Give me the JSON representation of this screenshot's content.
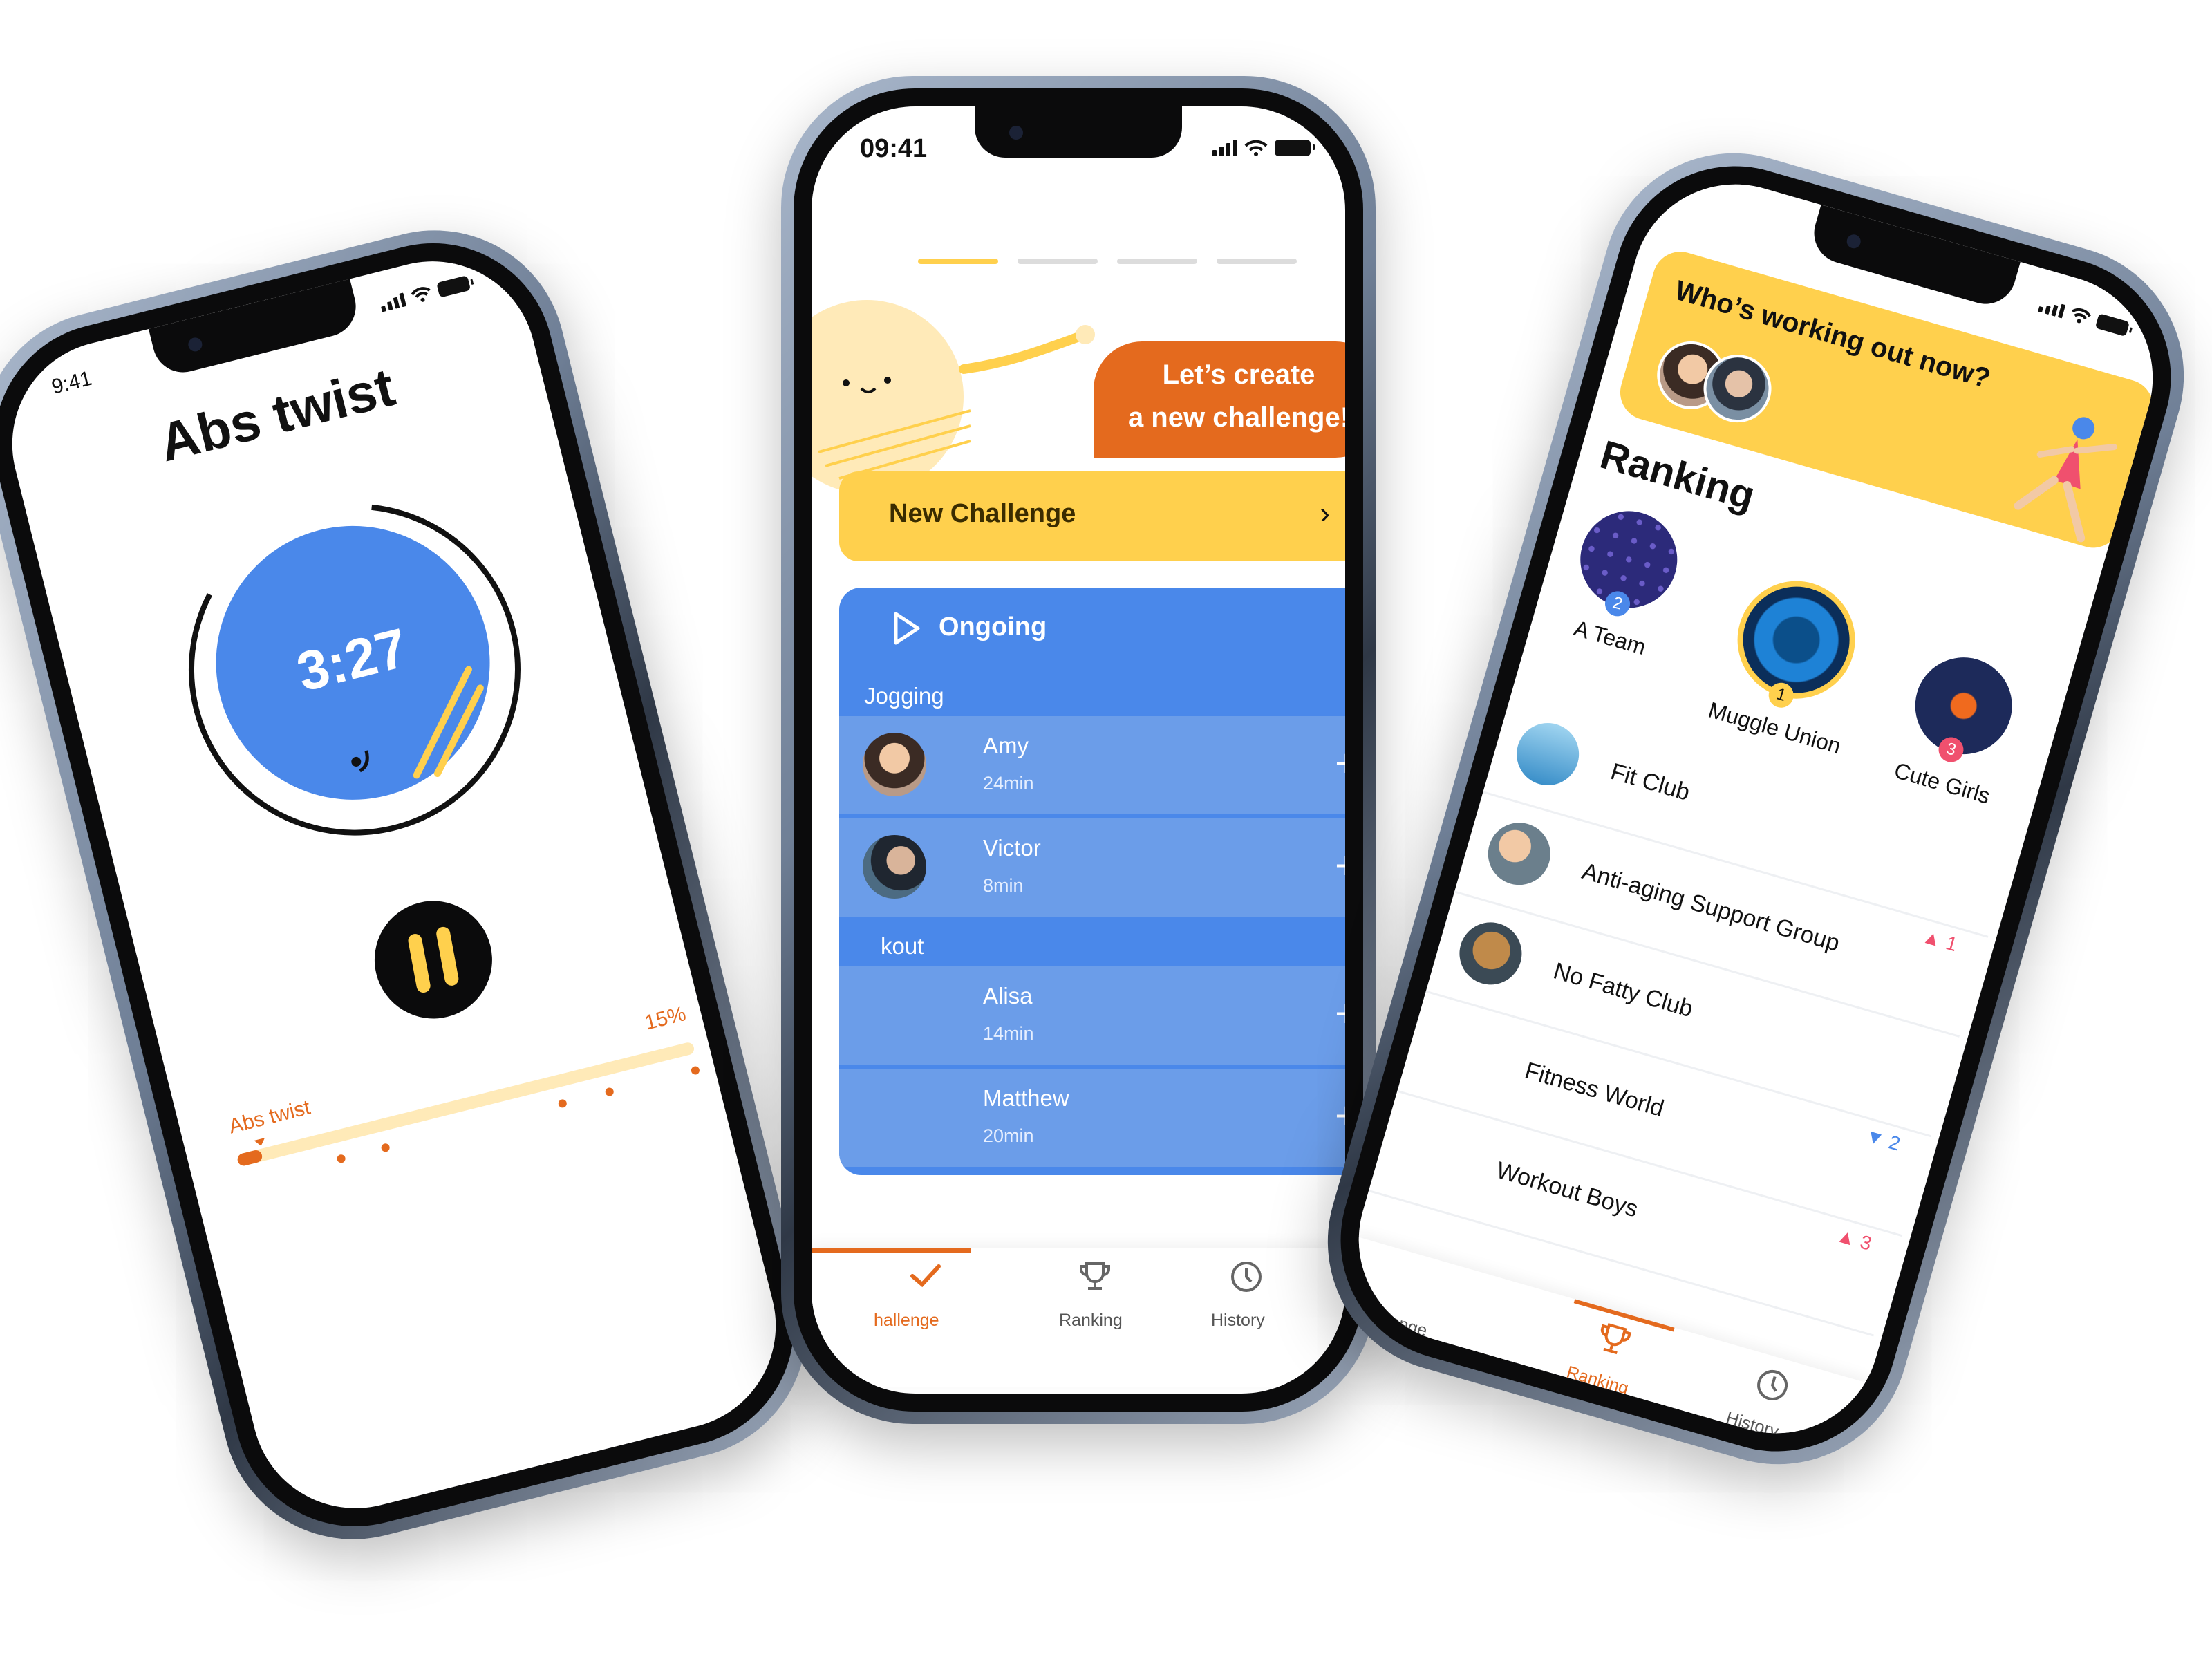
{
  "left": {
    "status_time": "9:41",
    "title": "Abs twist",
    "timer": "3:27",
    "progress_label": "Abs twist",
    "progress_percent": "15%",
    "progress_fraction": 0.15
  },
  "center": {
    "status_time": "09:41",
    "banner": {
      "line1": "Let’s create",
      "line2": "a new challenge!"
    },
    "new_challenge_label": "New Challenge",
    "ongoing_label": "Ongoing",
    "groups": [
      {
        "name": "Jogging",
        "items": [
          {
            "name": "Amy",
            "duration": "24min"
          },
          {
            "name": "Victor",
            "duration": "8min"
          }
        ]
      },
      {
        "name": "kout",
        "items": [
          {
            "name": "Alisa",
            "duration": "14min"
          },
          {
            "name": "Matthew",
            "duration": "20min"
          }
        ]
      }
    ],
    "tabs": {
      "challenge": "hallenge",
      "ranking": "Ranking",
      "history": "History"
    }
  },
  "right": {
    "banner_title": "Who’s working out now?",
    "ranking_title": "Ranking",
    "podium": [
      {
        "name": "A Team",
        "rank": "2"
      },
      {
        "name": "Muggle Union",
        "rank": "1"
      },
      {
        "name": "Cute Girls",
        "rank": "3"
      }
    ],
    "list": [
      {
        "name": "Fit Club",
        "change": ""
      },
      {
        "name": "Anti-aging Support Group",
        "change": "1",
        "direction": "up"
      },
      {
        "name": "No Fatty Club",
        "change": ""
      },
      {
        "name": "Fitness World",
        "change": "2",
        "direction": "down"
      },
      {
        "name": "Workout Boys",
        "change": "3",
        "direction": "up"
      }
    ],
    "tabs": {
      "challenge": "llenge",
      "ranking": "Ranking",
      "history": "History"
    }
  },
  "colors": {
    "blue": "#4a88ea",
    "yellow": "#ffd04d",
    "orange": "#e46a1e",
    "red": "#f0506e"
  }
}
